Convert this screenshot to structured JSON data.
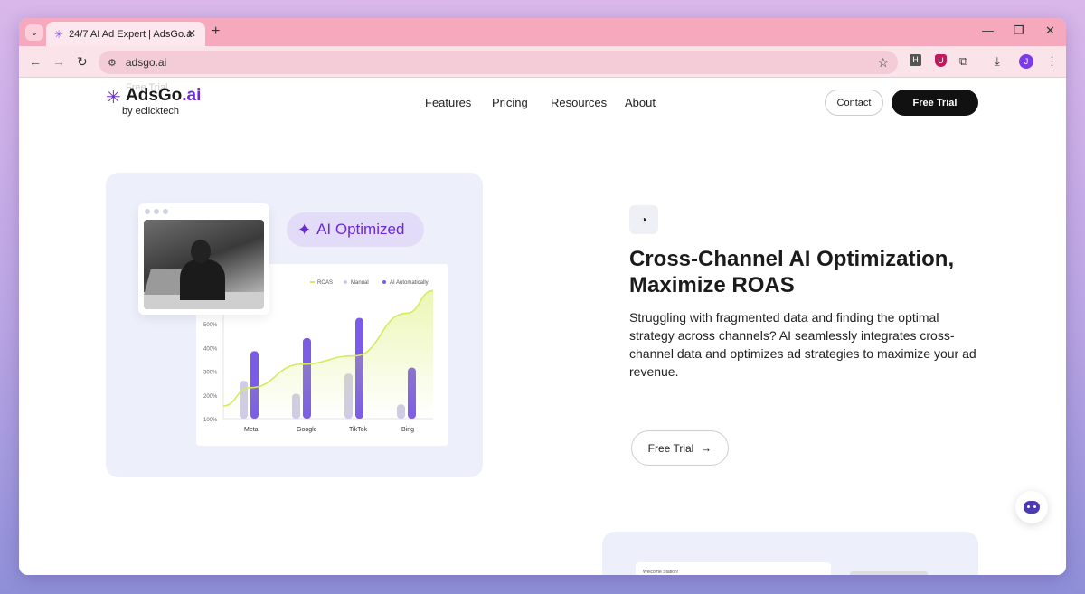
{
  "browser": {
    "tab_title": "24/7 AI Ad Expert | AdsGo.ai",
    "url": "adsgo.ai",
    "avatar_initial": "J",
    "ext_h_label": "H",
    "ext_u_label": "U"
  },
  "header": {
    "logo_name": "AdsGo",
    "logo_suffix": ".ai",
    "logo_byline": "by eclicktech",
    "ghost_text": "Free Trial",
    "nav": [
      "Features",
      "Pricing",
      "Resources",
      "About"
    ],
    "contact_label": "Contact",
    "free_trial_label": "Free Trial"
  },
  "feature": {
    "badge": "AI Optimized",
    "headline": "Cross-Channel AI Optimization, Maximize ROAS",
    "description": "Struggling with fragmented data and finding the optimal strategy across channels? AI seamlessly integrates cross-channel data and optimizes ad strategies to maximize your ad revenue.",
    "cta_label": "Free Trial",
    "cta_arrow": "→"
  },
  "bottom": {
    "preview_text": "Welcome Station!"
  },
  "colors": {
    "accent": "#6d28d9",
    "roas_line": "#d4ec5a",
    "manual_bar": "#cfcbe8",
    "ai_bar": "#7c5ce6"
  },
  "chart_data": {
    "type": "bar",
    "categories": [
      "Meta",
      "Google",
      "TikTok",
      "Bing"
    ],
    "series": [
      {
        "name": "Manual",
        "values": [
          260,
          205,
          290,
          160
        ]
      },
      {
        "name": "AI Automatically",
        "values": [
          385,
          440,
          525,
          315
        ]
      },
      {
        "name": "ROAS",
        "values": [
          230,
          330,
          365,
          545
        ]
      }
    ],
    "legend": [
      "ROAS",
      "Manual",
      "AI Automatically"
    ],
    "y_ticks": [
      "500%",
      "400%",
      "300%",
      "200%",
      "100%"
    ],
    "ylim": [
      100,
      600
    ]
  }
}
